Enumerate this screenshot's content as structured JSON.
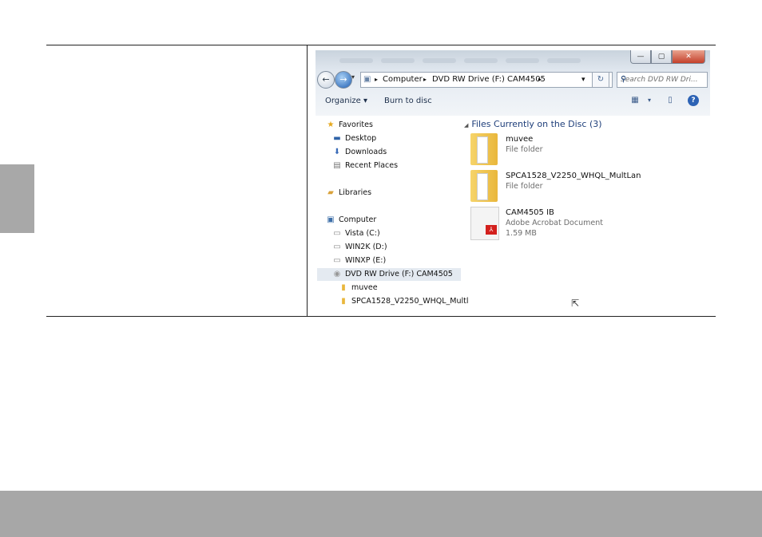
{
  "window": {
    "controls": {
      "minimize": "—",
      "maximize": "▢",
      "close": "✕"
    }
  },
  "address_bar": {
    "crumbs": [
      "Computer",
      "DVD RW Drive (F:) CAM4505"
    ],
    "separator": "▸",
    "dropdown": "▾",
    "refresh": "↻",
    "search_placeholder": "Search DVD RW Dri...",
    "search_icon": "⚲"
  },
  "toolbar": {
    "organize_label": "Organize ▾",
    "burn_label": "Burn to disc",
    "views_icon": "▦",
    "views_dropdown": "▾",
    "preview_icon": "▯",
    "help_icon": "?"
  },
  "nav_pane": {
    "favorites": "Favorites",
    "desktop": "Desktop",
    "downloads": "Downloads",
    "recent_places": "Recent Places",
    "libraries": "Libraries",
    "computer": "Computer",
    "drives": [
      "Vista (C:)",
      "WIN2K (D:)",
      "WINXP (E:)"
    ],
    "dvd_drive": "DVD RW Drive (F:) CAM4505",
    "dvd_children": [
      "muvee",
      "SPCA1528_V2250_WHQL_Multl"
    ]
  },
  "content": {
    "group_header": "Files Currently on the Disc (3)",
    "files": [
      {
        "name": "muvee",
        "type": "File folder",
        "size": ""
      },
      {
        "name": "SPCA1528_V2250_WHQL_MultLan",
        "type": "File folder",
        "size": ""
      },
      {
        "name": "CAM4505 IB",
        "type": "Adobe Acrobat Document",
        "size": "1.59 MB"
      }
    ]
  },
  "colors": {
    "page_band": "#a7a7a7",
    "link_blue": "#1e3e7a",
    "folder_yellow": "#e9b73c",
    "pdf_red": "#d3201d"
  }
}
